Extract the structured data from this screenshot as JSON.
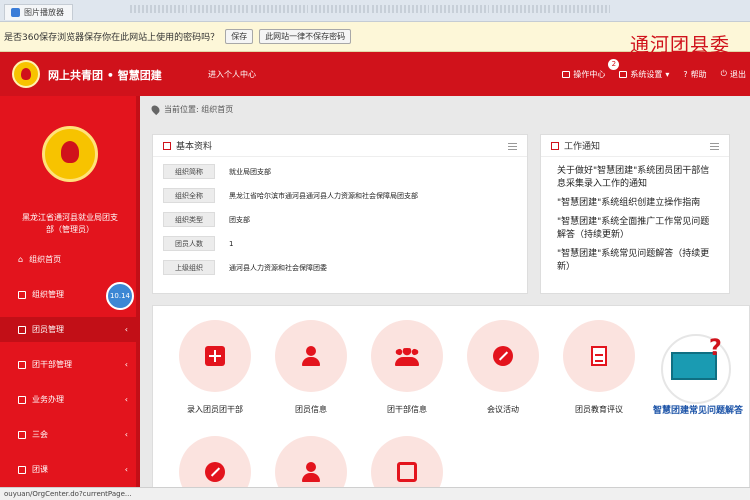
{
  "browser": {
    "tab_title": "图片播放器",
    "notification": "是否360保存浏览器保存你在此网站上使用的密码吗？",
    "save_label": "保存",
    "never_label": "此网站一律不保存密码",
    "status_url": "ouyuan/OrgCenter.do?currentPage..."
  },
  "overlay_title": "通河团县委",
  "header": {
    "title": "网上共青团 • 智慧团建",
    "subtitle": "进入个人中心",
    "ops_center": "操作中心",
    "ops_badge": "2",
    "system_settings": "系统设置",
    "help": "帮助",
    "exit": "退出"
  },
  "sidebar": {
    "org_name": "黑龙江省通河县就业局团支部（管理员）",
    "circle_label": "10.14",
    "items": [
      {
        "label": "组织首页",
        "arrow": ""
      },
      {
        "label": "组织管理",
        "arrow": "‹"
      },
      {
        "label": "团员管理",
        "arrow": "‹"
      },
      {
        "label": "团干部管理",
        "arrow": "‹"
      },
      {
        "label": "业务办理",
        "arrow": "‹"
      },
      {
        "label": "三会",
        "arrow": "‹"
      },
      {
        "label": "团课",
        "arrow": "‹"
      }
    ]
  },
  "breadcrumb": "当前位置: 组织首页",
  "basic_info": {
    "title": "基本资料",
    "rows": [
      {
        "key": "组织简称",
        "value": "就业局团支部"
      },
      {
        "key": "组织全称",
        "value": "黑龙江省哈尔滨市通河县通河县人力资源和社会保障局团支部"
      },
      {
        "key": "组织类型",
        "value": "团支部"
      },
      {
        "key": "团员人数",
        "value": "1"
      },
      {
        "key": "上级组织",
        "value": "通河县人力资源和社会保障团委"
      }
    ]
  },
  "work_notice": {
    "title": "工作通知",
    "items": [
      "关于做好\"智慧团建\"系统团员团干部信息采集录入工作的通知",
      "\"智慧团建\"系统组织创建立操作指南",
      "\"智慧团建\"系统全面推广工作常见问题解答（持续更新）",
      "\"智慧团建\"系统常见问题解答（持续更新）"
    ]
  },
  "tiles": [
    {
      "label": "录入团员团干部",
      "glyph": "plus-icon"
    },
    {
      "label": "团员信息",
      "glyph": "person-icon"
    },
    {
      "label": "团干部信息",
      "glyph": "group-icon"
    },
    {
      "label": "会议活动",
      "glyph": "edit-icon"
    },
    {
      "label": "团员教育评议",
      "glyph": "document-icon"
    },
    {
      "label": "",
      "glyph": "edit-icon"
    },
    {
      "label": "",
      "glyph": "person-icon"
    },
    {
      "label": "",
      "glyph": "refresh-icon"
    }
  ],
  "promo": {
    "label": "智慧团建常见问题解答"
  }
}
